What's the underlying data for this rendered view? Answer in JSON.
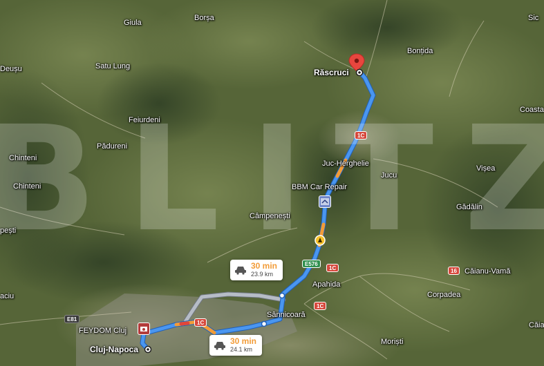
{
  "places": {
    "borsa": "Borșa",
    "giula": "Giula",
    "sic": "Sic",
    "bontida": "Bonțida",
    "satu_lung": "Satu Lung",
    "deusu": "Deușu",
    "rascruci": "Răscruci",
    "coasta": "Coasta",
    "feiurdeni": "Feiurdeni",
    "padureni": "Pădureni",
    "chinteni_1": "Chinteni",
    "chinteni_2": "Chinteni",
    "juc_herghelie": "Juc-Herghelie",
    "jucu": "Jucu",
    "visea": "Vișea",
    "bbm": "BBM Car Repair",
    "gadalin": "Gădălin",
    "campenesti": "Câmpenești",
    "pesti": "pești",
    "apahida": "Apahida",
    "caianu_vama": "Căianu-Vamă",
    "corpadea": "Corpadea",
    "aciu": "aciu",
    "sannicoara": "Sânnicoară",
    "feydom": "FEYDOM Cluj",
    "cluj_napoca": "Cluj-Napoca",
    "moristi": "Moriști",
    "caia": "Căia"
  },
  "roads": {
    "e81": "E81",
    "1c_a": "1C",
    "1c_b": "1C",
    "1c_c": "1C",
    "1c_d": "1C",
    "e576": "E576",
    "r16": "16"
  },
  "routes": {
    "alt": {
      "time": "30 min",
      "distance": "23.9 km"
    },
    "main": {
      "time": "30 min",
      "distance": "24.1 km"
    }
  },
  "watermark": "BLITZ",
  "colors": {
    "route": "#4a96f0",
    "route_slow": "#f29c38",
    "route_jam": "#e0463a",
    "alt_route": "#b6bcc6",
    "pin": "#e8463e"
  }
}
